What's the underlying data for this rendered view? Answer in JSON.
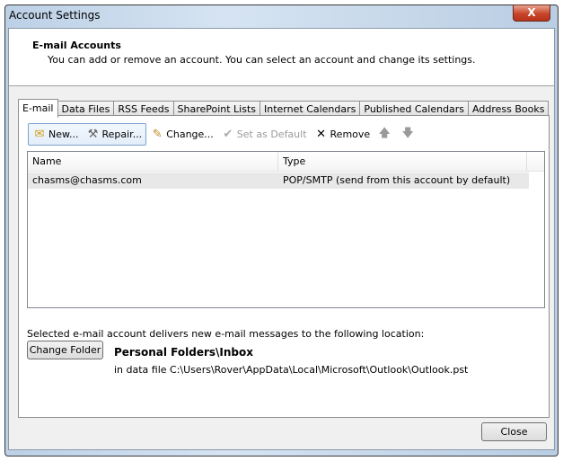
{
  "window": {
    "title": "Account Settings",
    "close_glyph": "X"
  },
  "header": {
    "title": "E-mail Accounts",
    "subtitle": "You can add or remove an account. You can select an account and change its settings."
  },
  "tabs": [
    {
      "label": "E-mail",
      "active": true
    },
    {
      "label": "Data Files"
    },
    {
      "label": "RSS Feeds"
    },
    {
      "label": "SharePoint Lists"
    },
    {
      "label": "Internet Calendars"
    },
    {
      "label": "Published Calendars"
    },
    {
      "label": "Address Books"
    }
  ],
  "toolbar": {
    "new": "New...",
    "repair": "Repair...",
    "change": "Change...",
    "set_default": "Set as Default",
    "remove": "Remove"
  },
  "list": {
    "columns": [
      "Name",
      "Type"
    ],
    "rows": [
      {
        "name": "chasms@chasms.com",
        "type": "POP/SMTP (send from this account by default)"
      }
    ]
  },
  "location": {
    "label": "Selected e-mail account delivers new e-mail messages to the following location:",
    "change_folder": "Change Folder",
    "folder": "Personal Folders\\Inbox",
    "data_file": "in data file C:\\Users\\Rover\\AppData\\Local\\Microsoft\\Outlook\\Outlook.pst"
  },
  "footer": {
    "close": "Close"
  }
}
